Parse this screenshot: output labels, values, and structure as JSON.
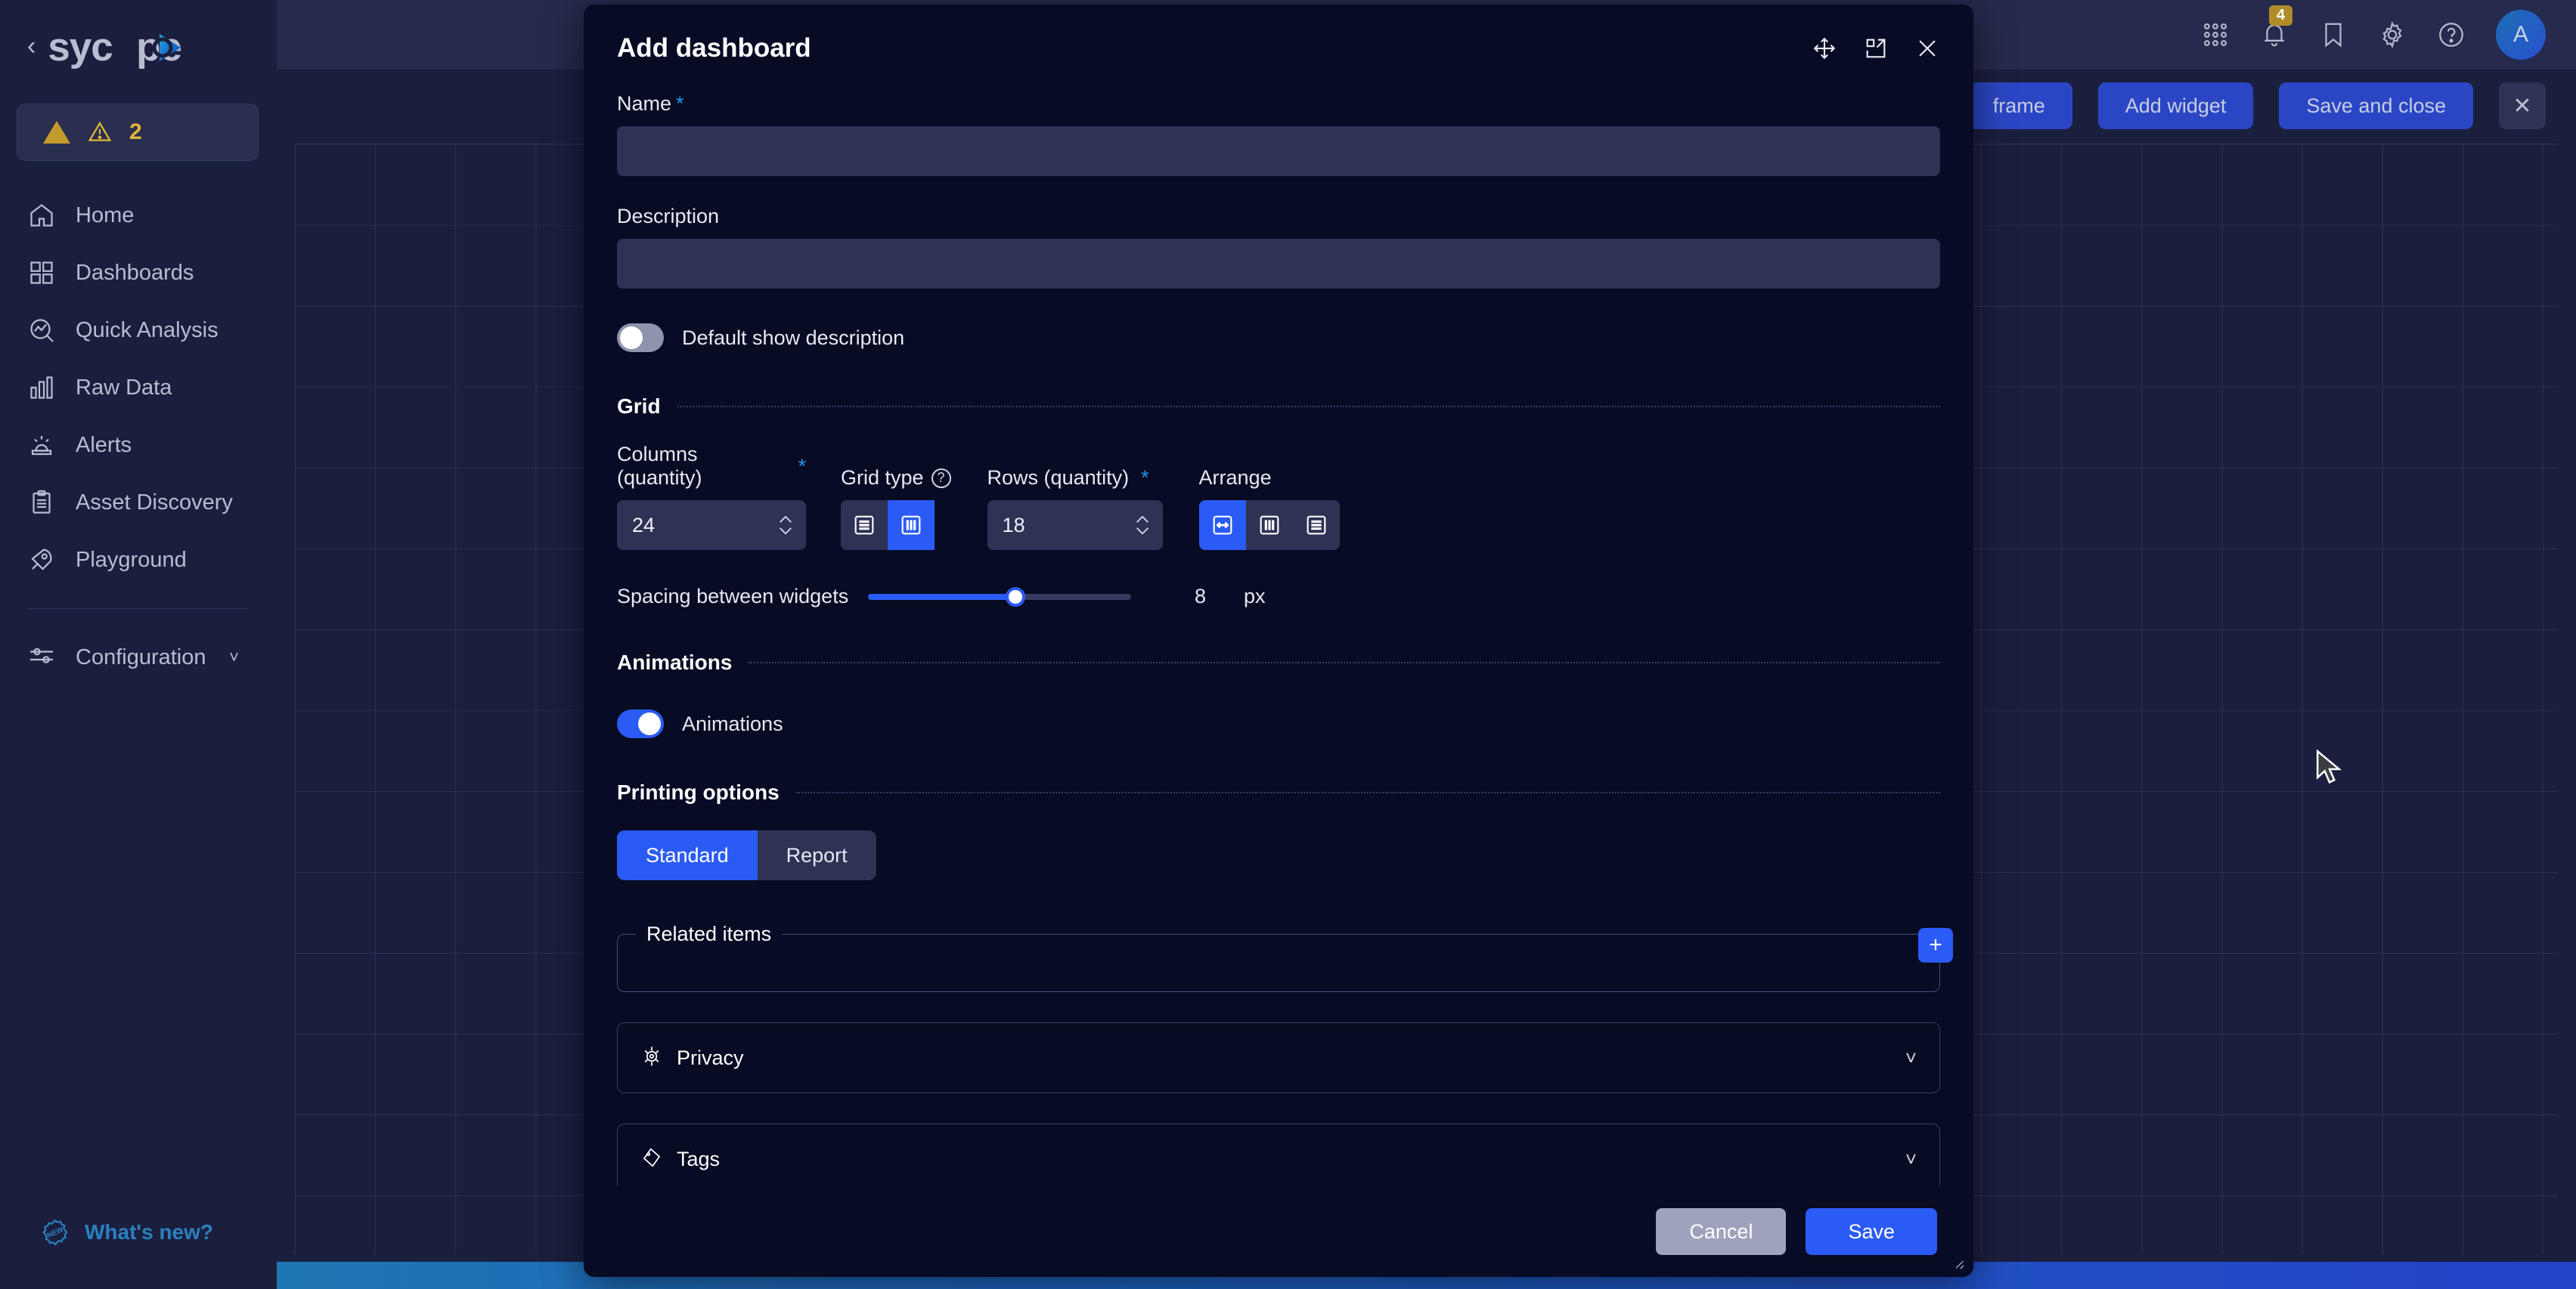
{
  "sidebar": {
    "logo_text": "syc",
    "logo_text2": "pe",
    "back_icon": "chevron-left-icon",
    "alert": {
      "count": "2",
      "icon": "warning-triangle-icon"
    },
    "items": [
      {
        "label": "Home",
        "icon": "home-icon"
      },
      {
        "label": "Dashboards",
        "icon": "grid-squares-icon"
      },
      {
        "label": "Quick Analysis",
        "icon": "analysis-chart-icon"
      },
      {
        "label": "Raw Data",
        "icon": "bar-chart-icon"
      },
      {
        "label": "Alerts",
        "icon": "siren-icon"
      },
      {
        "label": "Asset Discovery",
        "icon": "clipboard-list-icon"
      },
      {
        "label": "Playground",
        "icon": "rocket-icon"
      }
    ],
    "config": {
      "label": "Configuration",
      "icon": "sliders-icon",
      "chevron": "chevron-down-icon"
    },
    "whats_new": {
      "label": "What's new?",
      "icon": "new-badge-icon"
    }
  },
  "topbar": {
    "icons": [
      "apps-grid-icon",
      "bell-icon",
      "bookmark-icon",
      "gear-icon",
      "help-circle-icon"
    ],
    "notification_count": "4",
    "avatar_initial": "A"
  },
  "toolbar": {
    "buttons": [
      "frame",
      "Add widget",
      "Save and close"
    ],
    "close_label": "✕"
  },
  "modal": {
    "title": "Add dashboard",
    "header_icons": [
      "move-icon",
      "expand-icon",
      "close-icon"
    ],
    "name": {
      "label": "Name",
      "required": "*",
      "value": "",
      "placeholder": ""
    },
    "description": {
      "label": "Description",
      "value": "",
      "placeholder": ""
    },
    "default_show_description": {
      "label": "Default show description",
      "state": "off"
    },
    "grid": {
      "section_title": "Grid",
      "columns": {
        "label": "Columns (quantity)",
        "required": "*",
        "value": "24"
      },
      "grid_type": {
        "label": "Grid type",
        "help_icon": "question-circle-icon",
        "options": [
          "rows-layout-icon",
          "columns-layout-icon"
        ],
        "selected_index": 1
      },
      "rows": {
        "label": "Rows (quantity)",
        "required": "*",
        "value": "18"
      },
      "arrange": {
        "label": "Arrange",
        "options": [
          "horizontal-arrows-icon",
          "columns-layout-icon",
          "rows-layout-icon"
        ],
        "selected_index": 0
      },
      "spacing": {
        "label": "Spacing between widgets",
        "value": "8",
        "unit": "px",
        "percent": 56
      }
    },
    "animations": {
      "section_title": "Animations",
      "toggle_label": "Animations",
      "state": "on"
    },
    "printing": {
      "section_title": "Printing options",
      "options": [
        "Standard",
        "Report"
      ],
      "selected_index": 0
    },
    "related_items": {
      "legend": "Related items",
      "add_label": "+"
    },
    "privacy": {
      "title": "Privacy",
      "icon": "privacy-eye-icon",
      "chevron": "chevron-down-icon"
    },
    "tags": {
      "title": "Tags",
      "icon": "tag-icon",
      "chevron": "chevron-down-icon"
    },
    "footer": {
      "cancel": "Cancel",
      "save": "Save"
    }
  },
  "colors": {
    "accent_blue": "#2b5bf5",
    "sidebar_bg": "#1b1f3e",
    "modal_bg": "#070b23",
    "input_bg": "#2e3254",
    "warn": "#e0b63a",
    "link_blue": "#2b80bf"
  }
}
